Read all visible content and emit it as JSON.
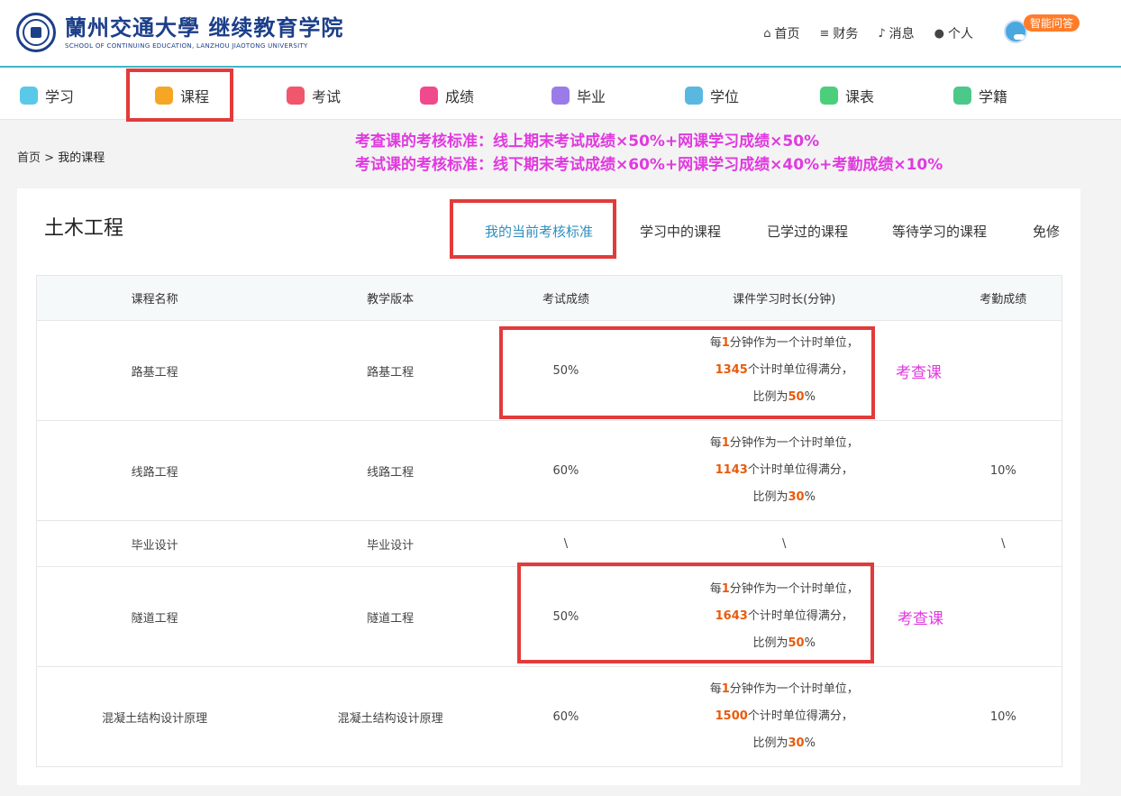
{
  "header": {
    "logo_cn": "蘭州交通大學 继续教育学院",
    "logo_en": "SCHOOL OF CONTINUING EDUCATION, LANZHOU JIAOTONG UNIVERSITY",
    "links": [
      {
        "label": "首页",
        "icon": "home-icon"
      },
      {
        "label": "财务",
        "icon": "database-icon"
      },
      {
        "label": "消息",
        "icon": "bell-icon"
      },
      {
        "label": "个人",
        "icon": "user-icon"
      }
    ],
    "assistant_label": "智能问答"
  },
  "mainnav": [
    {
      "label": "学习",
      "color": "#5ac8e8"
    },
    {
      "label": "课程",
      "color": "#f5a623"
    },
    {
      "label": "考试",
      "color": "#f0566c"
    },
    {
      "label": "成绩",
      "color": "#f04a8c"
    },
    {
      "label": "毕业",
      "color": "#9b7be8"
    },
    {
      "label": "学位",
      "color": "#5ab8e0"
    },
    {
      "label": "课表",
      "color": "#4ccf7a"
    },
    {
      "label": "学籍",
      "color": "#4cc88a"
    }
  ],
  "breadcrumb": {
    "home": "首页",
    "sep": ">",
    "current": "我的课程"
  },
  "notes": [
    "考查课的考核标准：线上期末考试成绩×50%+网课学习成绩×50%",
    "考试课的考核标准：线下期末考试成绩×60%+网课学习成绩×40%+考勤成绩×10%"
  ],
  "card": {
    "title": "土木工程",
    "tabs": [
      "我的当前考核标准",
      "学习中的课程",
      "已学过的课程",
      "等待学习的课程",
      "免修"
    ]
  },
  "table": {
    "headers": [
      "课程名称",
      "教学版本",
      "考试成绩",
      "课件学习时长(分钟)",
      "考勤成绩"
    ],
    "rows": [
      {
        "name": "路基工程",
        "version": "路基工程",
        "exam": "50%",
        "dur_pre": "每",
        "dur_min": "1",
        "dur_mid": "分钟作为一个计时单位，",
        "dur_units": "1345",
        "dur_units_txt": "个计时单位得满分，",
        "dur_ratio_pre": "比例为",
        "dur_ratio": "50",
        "dur_ratio_suf": "%",
        "attendance": ""
      },
      {
        "name": "线路工程",
        "version": "线路工程",
        "exam": "60%",
        "dur_pre": "每",
        "dur_min": "1",
        "dur_mid": "分钟作为一个计时单位，",
        "dur_units": "1143",
        "dur_units_txt": "个计时单位得满分，",
        "dur_ratio_pre": "比例为",
        "dur_ratio": "30",
        "dur_ratio_suf": "%",
        "attendance": "10%"
      },
      {
        "name": "毕业设计",
        "version": "毕业设计",
        "exam": "\\",
        "duration_plain": "\\",
        "attendance": "\\"
      },
      {
        "name": "隧道工程",
        "version": "隧道工程",
        "exam": "50%",
        "dur_pre": "每",
        "dur_min": "1",
        "dur_mid": "分钟作为一个计时单位，",
        "dur_units": "1643",
        "dur_units_txt": "个计时单位得满分，",
        "dur_ratio_pre": "比例为",
        "dur_ratio": "50",
        "dur_ratio_suf": "%",
        "attendance": ""
      },
      {
        "name": "混凝土结构设计原理",
        "version": "混凝土结构设计原理",
        "exam": "60%",
        "dur_pre": "每",
        "dur_min": "1",
        "dur_mid": "分钟作为一个计时单位，",
        "dur_units": "1500",
        "dur_units_txt": "个计时单位得满分，",
        "dur_ratio_pre": "比例为",
        "dur_ratio": "30",
        "dur_ratio_suf": "%",
        "attendance": "10%"
      }
    ]
  },
  "annotations": {
    "tag1": "考查课",
    "tag2": "考查课"
  }
}
